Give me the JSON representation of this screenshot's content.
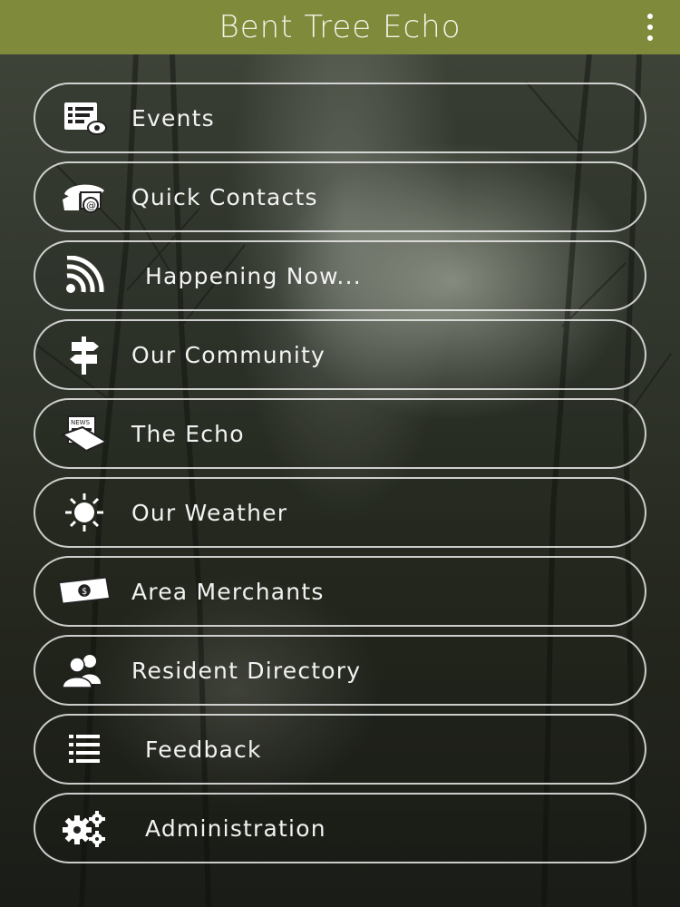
{
  "header": {
    "title": "Bent Tree Echo",
    "more_icon": "more-vert-icon"
  },
  "menu": {
    "items": [
      {
        "label": "Events",
        "icon": "events-icon"
      },
      {
        "label": "Quick Contacts",
        "icon": "contacts-icon"
      },
      {
        "label": "Happening Now...",
        "icon": "rss-icon"
      },
      {
        "label": "Our Community",
        "icon": "signpost-icon"
      },
      {
        "label": "The Echo",
        "icon": "newspaper-icon"
      },
      {
        "label": "Our Weather",
        "icon": "sun-icon"
      },
      {
        "label": "Area Merchants",
        "icon": "money-icon"
      },
      {
        "label": "Resident Directory",
        "icon": "people-icon"
      },
      {
        "label": "Feedback",
        "icon": "list-icon"
      },
      {
        "label": "Administration",
        "icon": "gears-icon"
      }
    ]
  },
  "colors": {
    "header_bg": "#7f8a3a",
    "text": "#f2f2f2",
    "pill_border": "#ebebeb"
  }
}
